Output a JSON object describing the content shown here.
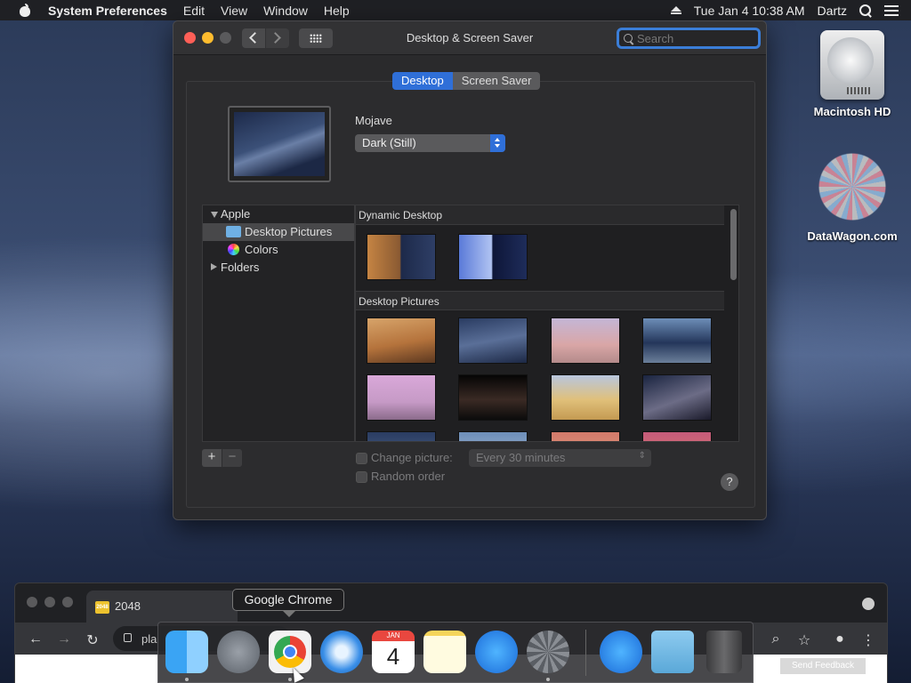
{
  "menubar": {
    "app_name": "System Preferences",
    "items": [
      "Edit",
      "View",
      "Window",
      "Help"
    ],
    "clock": "Tue Jan 4  10:38 AM",
    "user": "Dartz"
  },
  "desktop_icons": [
    {
      "label": "Macintosh HD"
    },
    {
      "label": "DataWagon.com"
    }
  ],
  "window": {
    "title": "Desktop & Screen Saver",
    "search_placeholder": "Search",
    "tabs": [
      {
        "label": "Desktop",
        "selected": true
      },
      {
        "label": "Screen Saver",
        "selected": false
      }
    ],
    "wallpaper_name": "Mojave",
    "appearance_value": "Dark (Still)",
    "sidebar": [
      {
        "label": "Apple",
        "expanded": true,
        "level": 0
      },
      {
        "label": "Desktop Pictures",
        "selected": true,
        "level": 1
      },
      {
        "label": "Colors",
        "level": 1
      },
      {
        "label": "Folders",
        "expanded": false,
        "level": 0
      }
    ],
    "sections": [
      {
        "title": "Dynamic Desktop"
      },
      {
        "title": "Desktop Pictures"
      }
    ],
    "change_picture_label": "Change picture:",
    "interval_value": "Every 30 minutes",
    "random_order_label": "Random order",
    "help_label": "?",
    "plus_label": "+",
    "minus_label": "−"
  },
  "chrome": {
    "tab_title": "2048",
    "favicon_text": "2048",
    "omnibox_text": "pla",
    "feedback_label": "Send Feedback"
  },
  "dock": {
    "tooltip": "Google Chrome",
    "calendar_month": "JAN",
    "calendar_day": "4",
    "apps": [
      "Finder",
      "Launchpad",
      "Google Chrome",
      "Safari",
      "Calendar",
      "Notes",
      "App Store",
      "System Preferences",
      "App Store",
      "Downloads",
      "Trash"
    ]
  },
  "colors": {
    "accent": "#2f6fd8",
    "window_bg": "#2a2a2c",
    "close": "#fe5f57",
    "minimize": "#febc2e"
  }
}
